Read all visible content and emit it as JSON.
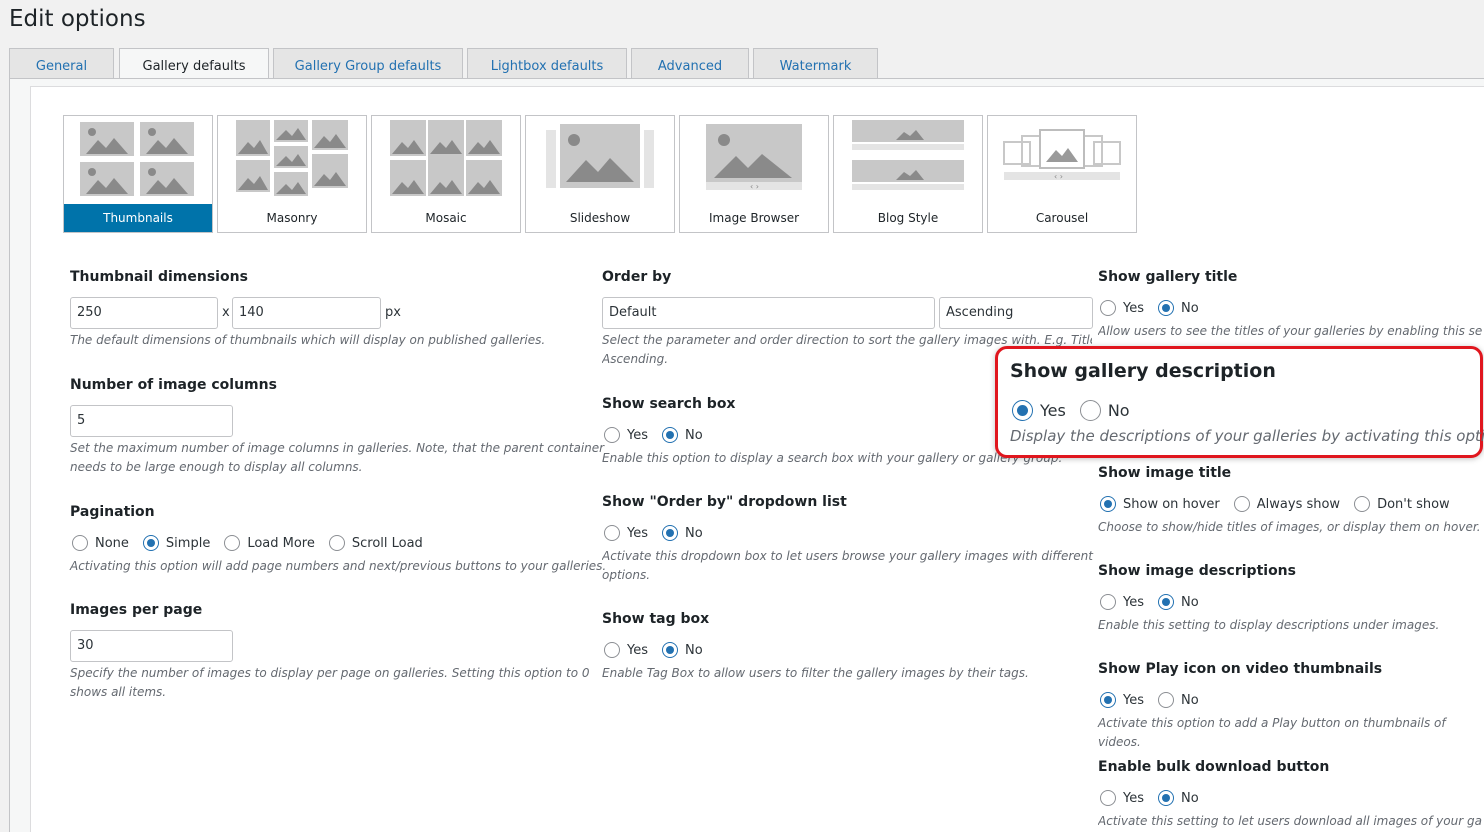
{
  "page_title": "Edit options",
  "tabs": [
    "General",
    "Gallery defaults",
    "Gallery Group defaults",
    "Lightbox defaults",
    "Advanced",
    "Watermark"
  ],
  "active_tab": "Gallery defaults",
  "views": [
    "Thumbnails",
    "Masonry",
    "Mosaic",
    "Slideshow",
    "Image Browser",
    "Blog Style",
    "Carousel"
  ],
  "active_view": "Thumbnails",
  "left": {
    "thumb_dims": {
      "label": "Thumbnail dimensions",
      "width": "250",
      "x": "x",
      "height": "140",
      "unit": "px",
      "desc": "The default dimensions of thumbnails which will display on published galleries."
    },
    "columns": {
      "label": "Number of image columns",
      "value": "5",
      "desc1": "Set the maximum number of image columns in galleries. Note, that the parent container",
      "desc2": "needs to be large enough to display all columns."
    },
    "pagination": {
      "label": "Pagination",
      "options": [
        "None",
        "Simple",
        "Load More",
        "Scroll Load"
      ],
      "selected": "Simple",
      "desc": "Activating this option will add page numbers and next/previous buttons to your galleries."
    },
    "per_page": {
      "label": "Images per page",
      "value": "30",
      "desc1": "Specify the number of images to display per page on galleries. Setting this option to 0",
      "desc2": "shows all items."
    }
  },
  "mid": {
    "order_by": {
      "label": "Order by",
      "value": "Default",
      "direction": "Ascending",
      "desc1": "Select the parameter and order direction to sort the gallery images with. E.g. Title and",
      "desc2": "Ascending."
    },
    "search_box": {
      "label": "Show search box",
      "yes": "Yes",
      "no": "No",
      "selected": "No",
      "desc": "Enable this option to display a search box with your gallery or gallery group."
    },
    "order_dropdown": {
      "label": "Show \"Order by\" dropdown list",
      "yes": "Yes",
      "no": "No",
      "selected": "No",
      "desc1": "Activate this dropdown box to let users browse your gallery images with different orderir",
      "desc2": "options."
    },
    "tag_box": {
      "label": "Show tag box",
      "yes": "Yes",
      "no": "No",
      "selected": "No",
      "desc": "Enable Tag Box to allow users to filter the gallery images by their tags."
    }
  },
  "right": {
    "gallery_title": {
      "label": "Show gallery title",
      "yes": "Yes",
      "no": "No",
      "selected": "No",
      "desc": "Allow users to see the titles of your galleries by enabling this setting."
    },
    "gallery_description": {
      "label": "Show gallery description",
      "yes": "Yes",
      "no": "No",
      "selected": "Yes",
      "desc": "Display the descriptions of your galleries by activating this option."
    },
    "image_title": {
      "label": "Show image title",
      "options": [
        "Show on hover",
        "Always show",
        "Don't show"
      ],
      "selected": "Show on hover",
      "desc": "Choose to show/hide titles of images, or display them on hover."
    },
    "image_descriptions": {
      "label": "Show image descriptions",
      "yes": "Yes",
      "no": "No",
      "selected": "No",
      "desc": "Enable this setting to display descriptions under images."
    },
    "play_icon": {
      "label": "Show Play icon on video thumbnails",
      "yes": "Yes",
      "no": "No",
      "selected": "Yes",
      "desc": "Activate this option to add a Play button on thumbnails of videos."
    },
    "bulk_download": {
      "label": "Enable bulk download button",
      "yes": "Yes",
      "no": "No",
      "selected": "No",
      "desc": "Activate this setting to let users download all images of your gallery v"
    }
  },
  "colors": {
    "accent": "#2271b1",
    "active_view": "#0073aa",
    "highlight_border": "#e0161e"
  }
}
